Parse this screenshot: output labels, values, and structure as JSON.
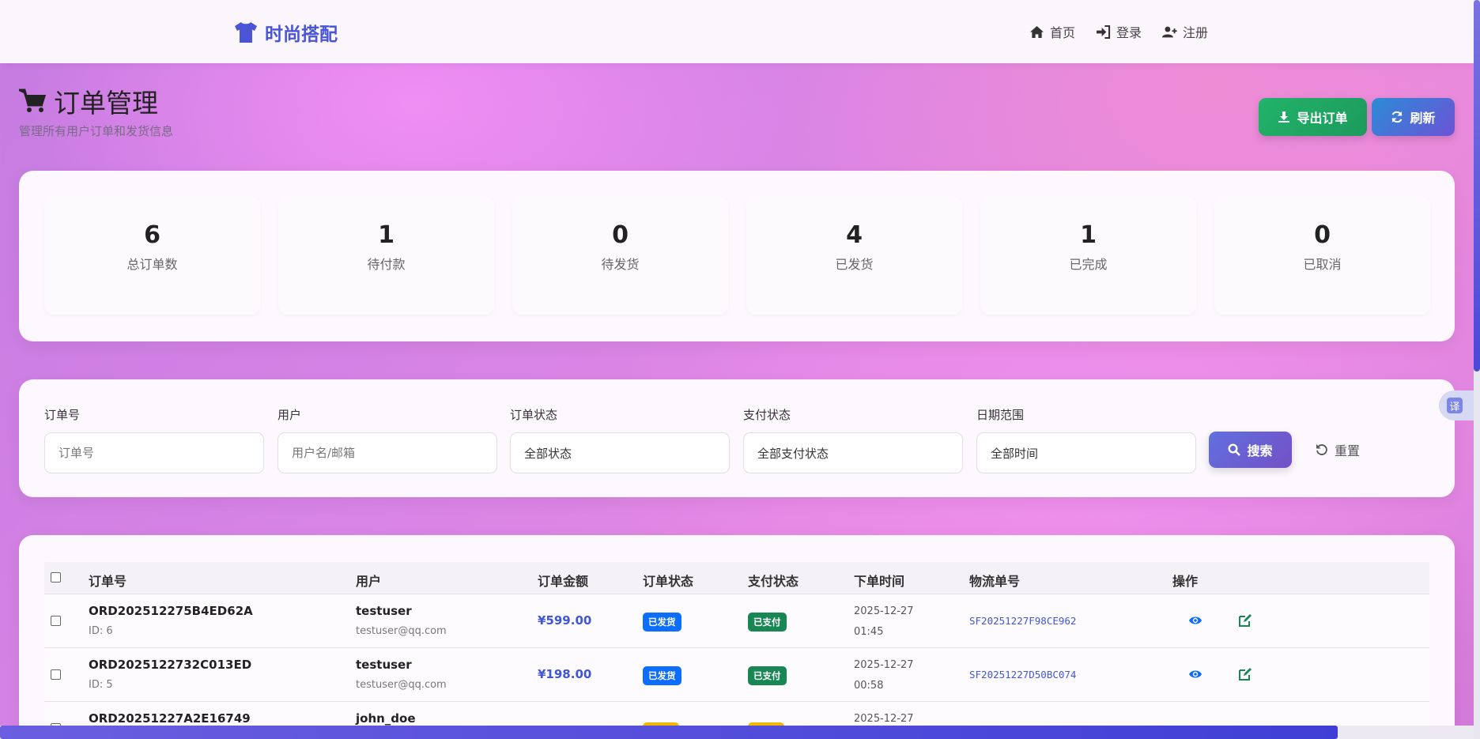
{
  "navbar": {
    "brand": "时尚搭配",
    "links": [
      {
        "label": "首页",
        "icon": "home-icon"
      },
      {
        "label": "登录",
        "icon": "sign-in-icon"
      },
      {
        "label": "注册",
        "icon": "user-plus-icon"
      }
    ]
  },
  "header": {
    "title": "订单管理",
    "subtitle": "管理所有用户订单和发货信息",
    "export_label": "导出订单",
    "refresh_label": "刷新"
  },
  "stats": [
    {
      "value": "6",
      "label": "总订单数"
    },
    {
      "value": "1",
      "label": "待付款"
    },
    {
      "value": "0",
      "label": "待发货"
    },
    {
      "value": "4",
      "label": "已发货"
    },
    {
      "value": "1",
      "label": "已完成"
    },
    {
      "value": "0",
      "label": "已取消"
    }
  ],
  "filters": {
    "order_no": {
      "label": "订单号",
      "placeholder": "订单号"
    },
    "user": {
      "label": "用户",
      "placeholder": "用户名/邮箱"
    },
    "order_status": {
      "label": "订单状态",
      "value": "全部状态"
    },
    "pay_status": {
      "label": "支付状态",
      "value": "全部支付状态"
    },
    "date_range": {
      "label": "日期范围",
      "value": "全部时间"
    },
    "search_label": "搜索",
    "reset_label": "重置"
  },
  "translate_label": "译",
  "table": {
    "columns": [
      "订单号",
      "用户",
      "订单金额",
      "订单状态",
      "支付状态",
      "下单时间",
      "物流单号",
      "操作"
    ],
    "rows": [
      {
        "order_no": "ORD202512275B4ED62A",
        "id": "ID: 6",
        "user": "testuser",
        "email": "testuser@qq.com",
        "amount": "¥599.00",
        "order_status": "已发货",
        "pay_status": "已支付",
        "date": "2025-12-27",
        "time": "01:45",
        "tracking": "SF20251227F98CE962"
      },
      {
        "order_no": "ORD2025122732C013ED",
        "id": "ID: 5",
        "user": "testuser",
        "email": "testuser@qq.com",
        "amount": "¥198.00",
        "order_status": "已发货",
        "pay_status": "已支付",
        "date": "2025-12-27",
        "time": "00:58",
        "tracking": "SF20251227D50BC074"
      },
      {
        "order_no": "ORD20251227A2E16749",
        "id": "",
        "user": "john_doe",
        "email": "",
        "amount": "",
        "order_status": "",
        "pay_status": "",
        "date": "2025-12-27",
        "time": "",
        "tracking": ""
      }
    ]
  },
  "colors": {
    "brand": "#4a55d6",
    "export": "#22b36a",
    "badge_shipped": "#0d6efd",
    "badge_paid": "#198754",
    "amount": "#3f57d6"
  }
}
